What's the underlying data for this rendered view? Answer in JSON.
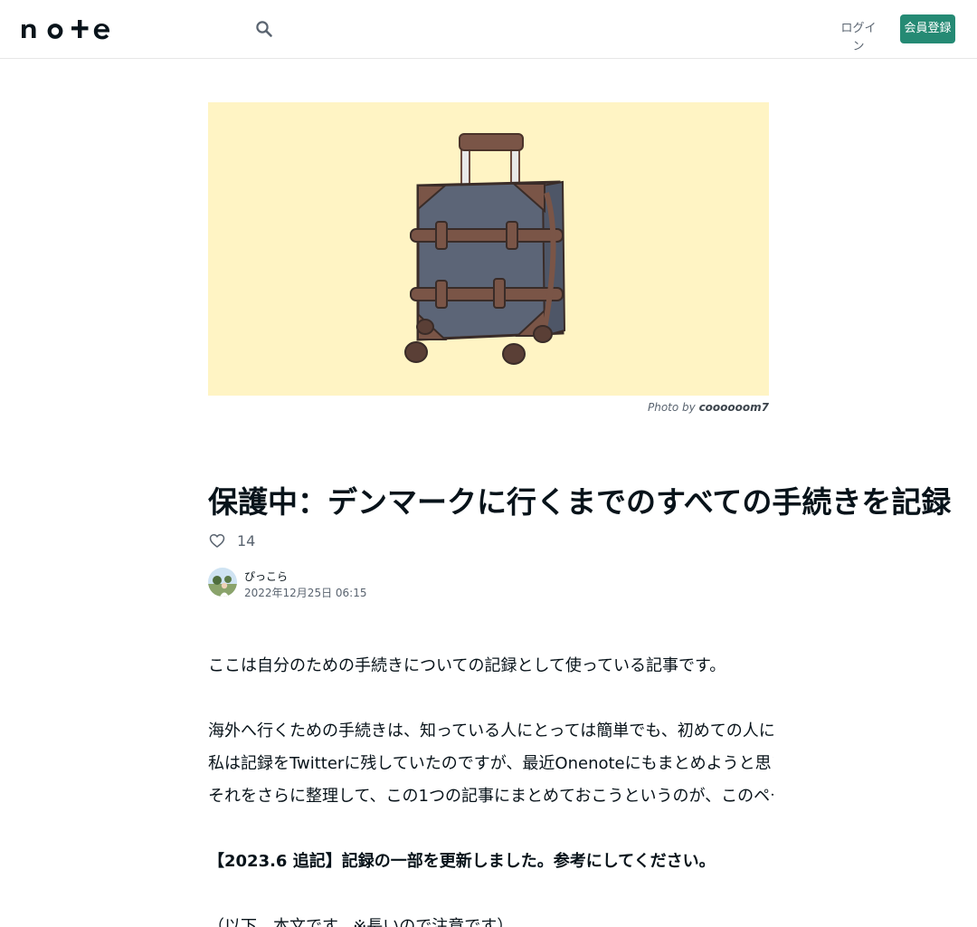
{
  "header": {
    "logo_text": "note",
    "search_icon": "search-icon",
    "login_label": "ログイン",
    "signup_label": "会員登録"
  },
  "hero": {
    "image_description_icon": "suitcase-illustration",
    "credit_prefix": "Photo by ",
    "credit_author": "coooooom7"
  },
  "article": {
    "title": "保護中：デンマークに行くまでのすべての手続きを記録",
    "like_icon": "heart-icon",
    "like_count": "14",
    "author_name": "ぴっこら",
    "date": "2022年12月25日 06:15",
    "paragraphs": [
      "ここは自分のための手続きについての記録として使っている記事です。",
      "海外へ行くための手続きは、知っている人にとっては簡単でも、初めての人にはとてもむずかしいものです。",
      "私は記録をTwitterに残していたのですが、最近Onenoteにもまとめようと思い立ちました。",
      "それをさらに整理して、この1つの記事にまとめておこうというのが、このページの目的です。",
      "【2023.6 追記】記録の一部を更新しました。参考にしてください。",
      "（以下、本文です。※長いので注意です）"
    ]
  },
  "colors": {
    "brand_green": "#258a74",
    "hero_background": "#fff4c4",
    "text_primary": "#08131a",
    "text_secondary": "#5a6470"
  }
}
